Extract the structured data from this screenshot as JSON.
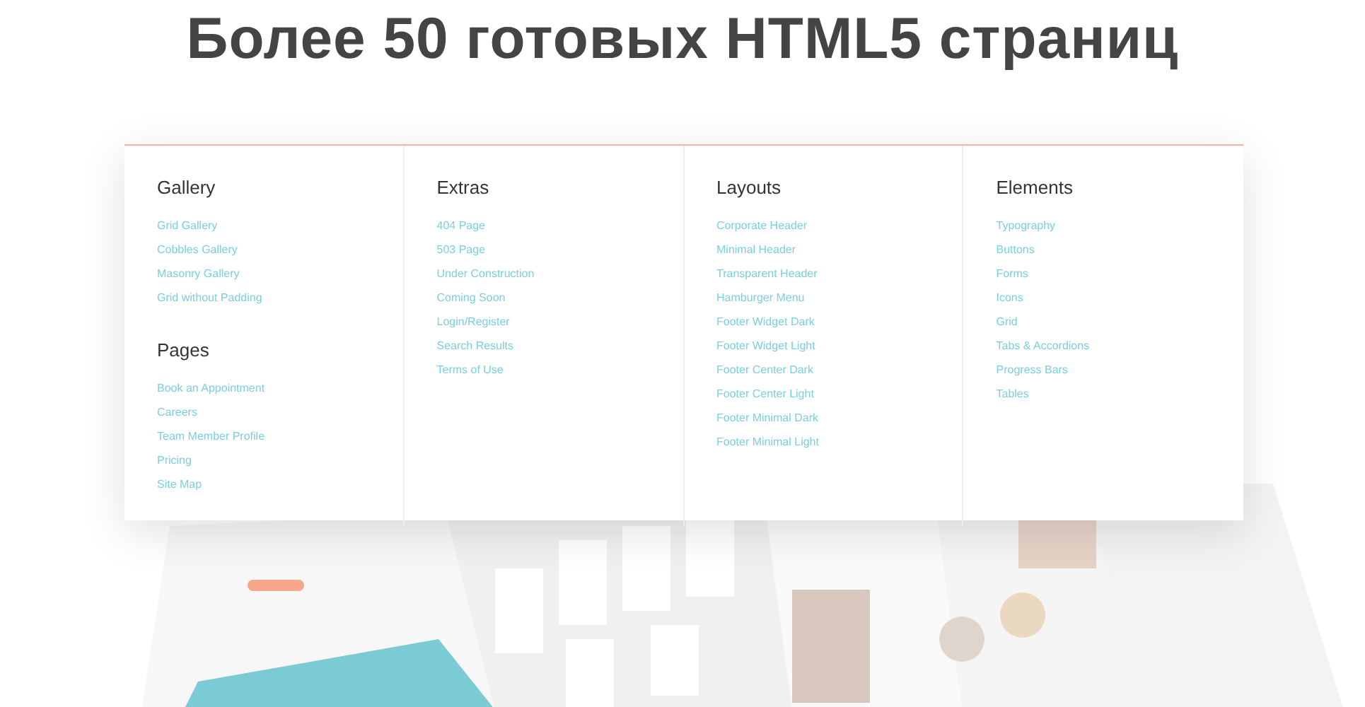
{
  "title": "Более 50 готовых HTML5 страниц",
  "menu": {
    "columns": [
      {
        "groups": [
          {
            "heading": "Gallery",
            "links": [
              "Grid Gallery",
              "Cobbles Gallery",
              "Masonry Gallery",
              "Grid without Padding"
            ]
          },
          {
            "heading": "Pages",
            "links": [
              "Book an Appointment",
              "Careers",
              "Team Member Profile",
              "Pricing",
              "Site Map"
            ]
          }
        ]
      },
      {
        "groups": [
          {
            "heading": "Extras",
            "links": [
              "404 Page",
              "503 Page",
              "Under Construction",
              "Coming Soon",
              "Login/Register",
              "Search Results",
              "Terms of Use"
            ]
          }
        ]
      },
      {
        "groups": [
          {
            "heading": "Layouts",
            "links": [
              "Corporate Header",
              "Minimal Header",
              "Transparent Header",
              "Hamburger Menu",
              "Footer Widget Dark",
              "Footer Widget Light",
              "Footer Center Dark",
              "Footer Center Light",
              "Footer Minimal Dark",
              "Footer Minimal Light"
            ]
          }
        ]
      },
      {
        "groups": [
          {
            "heading": "Elements",
            "links": [
              "Typography",
              "Buttons",
              "Forms",
              "Icons",
              "Grid",
              "Tabs & Accordions",
              "Progress Bars",
              "Tables"
            ]
          }
        ]
      }
    ]
  }
}
